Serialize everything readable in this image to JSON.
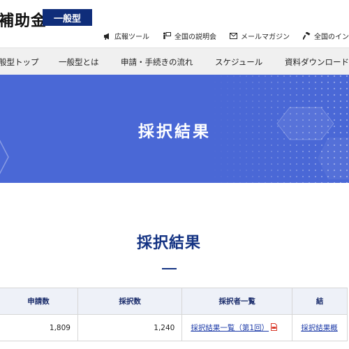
{
  "header": {
    "site_title": "補助金",
    "type_badge": "一般型",
    "utility_links": [
      {
        "label": "広報ツール",
        "icon": "megaphone-icon"
      },
      {
        "label": "全国の説明会",
        "icon": "presentation-icon"
      },
      {
        "label": "メールマガジン",
        "icon": "mail-icon"
      },
      {
        "label": "全国のインフ",
        "icon": "hammer-icon"
      }
    ]
  },
  "nav": {
    "items": [
      "般型トップ",
      "一般型とは",
      "申請・手続きの流れ",
      "スケジュール",
      "資料ダウンロード"
    ]
  },
  "hero": {
    "title": "採択結果",
    "background_color": "#4a68d6"
  },
  "section": {
    "title": "採択結果",
    "accent_color": "#143383"
  },
  "table": {
    "headers": [
      "申請数",
      "採択数",
      "採択者一覧",
      "結"
    ],
    "rows": [
      {
        "applications": "1,809",
        "adopted": "1,240",
        "list_link": "採択結果一覧（第1回）",
        "summary_link": "採択結果概"
      }
    ]
  }
}
